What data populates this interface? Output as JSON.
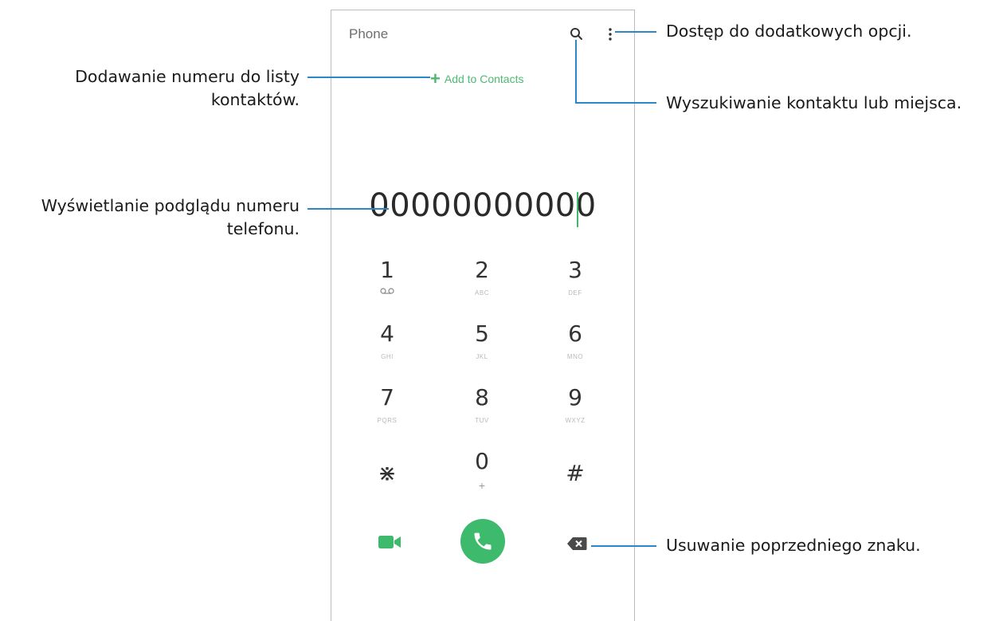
{
  "app": {
    "title": "Phone",
    "add_to_contacts": "Add to Contacts",
    "add_plus": "+",
    "number": "00000000000"
  },
  "icons": {
    "search": "search-icon",
    "more": "more-options-icon",
    "video": "video-call-icon",
    "call": "phone-icon",
    "backspace": "backspace-icon",
    "voicemail": "voicemail-icon"
  },
  "keypad": [
    {
      "digit": "1",
      "letters": ""
    },
    {
      "digit": "2",
      "letters": "ABC"
    },
    {
      "digit": "3",
      "letters": "DEF"
    },
    {
      "digit": "4",
      "letters": "GHI"
    },
    {
      "digit": "5",
      "letters": "JKL"
    },
    {
      "digit": "6",
      "letters": "MNO"
    },
    {
      "digit": "7",
      "letters": "PQRS"
    },
    {
      "digit": "8",
      "letters": "TUV"
    },
    {
      "digit": "9",
      "letters": "WXYZ"
    },
    {
      "digit": "⋇",
      "letters": ""
    },
    {
      "digit": "0",
      "letters": "+"
    },
    {
      "digit": "#",
      "letters": ""
    }
  ],
  "callouts": {
    "more_options": "Dostęp do dodatkowych opcji.",
    "add_contact_line1": "Dodawanie numeru do listy",
    "add_contact_line2": "kontaktów.",
    "search": "Wyszukiwanie kontaktu lub miejsca.",
    "preview_line1": "Wyświetlanie podglądu numeru",
    "preview_line2": "telefonu.",
    "delete": "Usuwanie poprzedniego znaku."
  },
  "colors": {
    "accent_green": "#3dba6b",
    "callout_line": "#2b87c8",
    "frame": "#bdbdbd"
  }
}
